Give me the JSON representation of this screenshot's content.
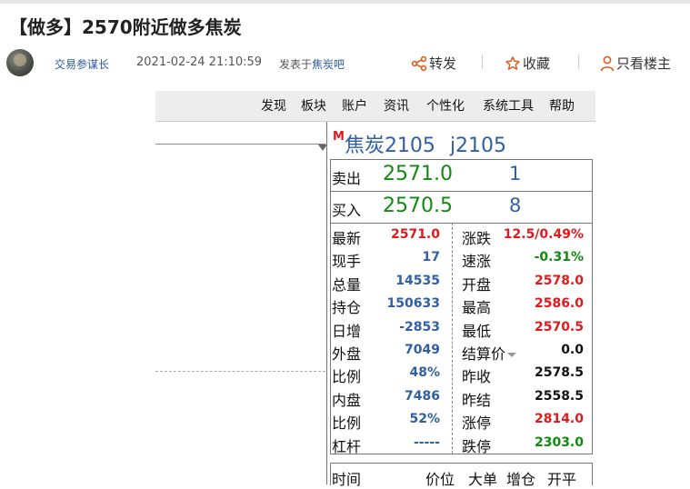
{
  "post": {
    "title": "【做多】2570附近做多焦炭",
    "author": "交易参谋长",
    "time": "2021-02-24 21:10:59",
    "posted_prefix": "发表于",
    "bar_name": "焦炭吧",
    "actions": {
      "share": "转发",
      "favorite": "收藏",
      "only_op": "只看楼主"
    }
  },
  "screenshot": {
    "menu": [
      "发现",
      "板块",
      "账户",
      "资讯",
      "个性化",
      "系统工具",
      "帮助"
    ],
    "quote": {
      "marker": "M",
      "name": "焦炭2105",
      "code": "j2105",
      "ask": {
        "label": "卖出",
        "price": "2571.0",
        "volume": "1"
      },
      "bid": {
        "label": "买入",
        "price": "2570.5",
        "volume": "8"
      },
      "rows": [
        {
          "k1": "最新",
          "v1": "2571.0",
          "c1": "red",
          "k2": "涨跌",
          "v2": "12.5/0.49%",
          "c2": "red"
        },
        {
          "k1": "现手",
          "v1": "17",
          "c1": "blue",
          "k2": "速涨",
          "v2": "-0.31%",
          "c2": "green"
        },
        {
          "k1": "总量",
          "v1": "14535",
          "c1": "blue",
          "k2": "开盘",
          "v2": "2578.0",
          "c2": "red"
        },
        {
          "k1": "持仓",
          "v1": "150633",
          "c1": "blue",
          "k2": "最高",
          "v2": "2586.0",
          "c2": "red"
        },
        {
          "k1": "日增",
          "v1": "-2853",
          "c1": "blue",
          "k2": "最低",
          "v2": "2570.5",
          "c2": "red"
        },
        {
          "k1": "外盘",
          "v1": "7049",
          "c1": "blue",
          "k2": "结算价",
          "v2": "0.0",
          "c2": "black",
          "dropdown": true
        },
        {
          "k1": "比例",
          "v1": "48%",
          "c1": "blue",
          "k2": "昨收",
          "v2": "2578.5",
          "c2": "black"
        },
        {
          "k1": "内盘",
          "v1": "7486",
          "c1": "blue",
          "k2": "昨结",
          "v2": "2558.5",
          "c2": "black"
        },
        {
          "k1": "比例",
          "v1": "52%",
          "c1": "blue",
          "k2": "涨停",
          "v2": "2814.0",
          "c2": "red"
        },
        {
          "k1": "杠杆",
          "v1": "-----",
          "c1": "blue",
          "k2": "跌停",
          "v2": "2303.0",
          "c2": "green"
        }
      ],
      "trade_headers": [
        "时间",
        "价位",
        "大单",
        "增仓",
        "开平"
      ]
    }
  },
  "colors": {
    "up": "#e0191c",
    "down": "#118a11",
    "neutral": "#2f5fa5",
    "link": "#2b5aa6"
  }
}
